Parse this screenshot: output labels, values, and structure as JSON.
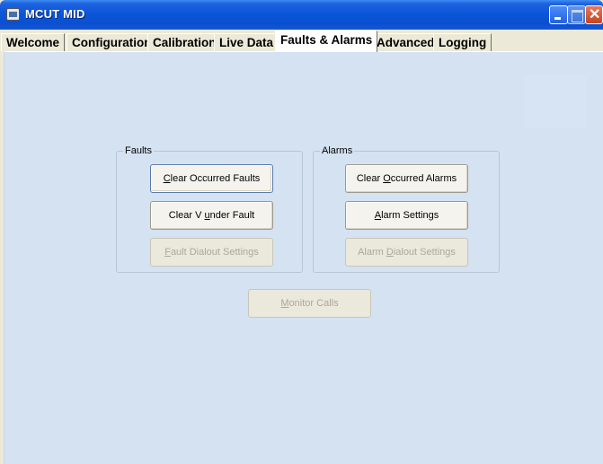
{
  "window": {
    "title": "MCUT MID"
  },
  "tabs": [
    {
      "label": "Welcome"
    },
    {
      "label": "Configuration"
    },
    {
      "label": "Calibration"
    },
    {
      "label": "Live Data"
    },
    {
      "label": "Faults & Alarms",
      "active": true
    },
    {
      "label": "Advanced"
    },
    {
      "label": "Logging"
    }
  ],
  "faults": {
    "label": "Faults",
    "clear_occurred": {
      "mnemonic": "C",
      "rest": "lear Occurred Faults"
    },
    "clear_v_under": {
      "pre": "Clear V ",
      "mnemonic": "u",
      "rest": "nder Fault"
    },
    "dialout": {
      "mnemonic": "F",
      "rest": "ault Dialout Settings",
      "disabled": true
    }
  },
  "alarms": {
    "label": "Alarms",
    "clear_occurred": {
      "pre": "Clear ",
      "mnemonic": "O",
      "rest": "ccurred Alarms"
    },
    "settings": {
      "mnemonic": "A",
      "rest": "larm Settings"
    },
    "dialout": {
      "pre": "Alarm ",
      "mnemonic": "D",
      "rest": "ialout Settings",
      "disabled": true
    }
  },
  "monitor_calls": {
    "mnemonic": "M",
    "rest": "onitor Calls",
    "disabled": true
  },
  "colors": {
    "panel_bg": "#d4e2f2",
    "titlebar": "#0a4fd1",
    "disabled_text": "#aca899"
  }
}
